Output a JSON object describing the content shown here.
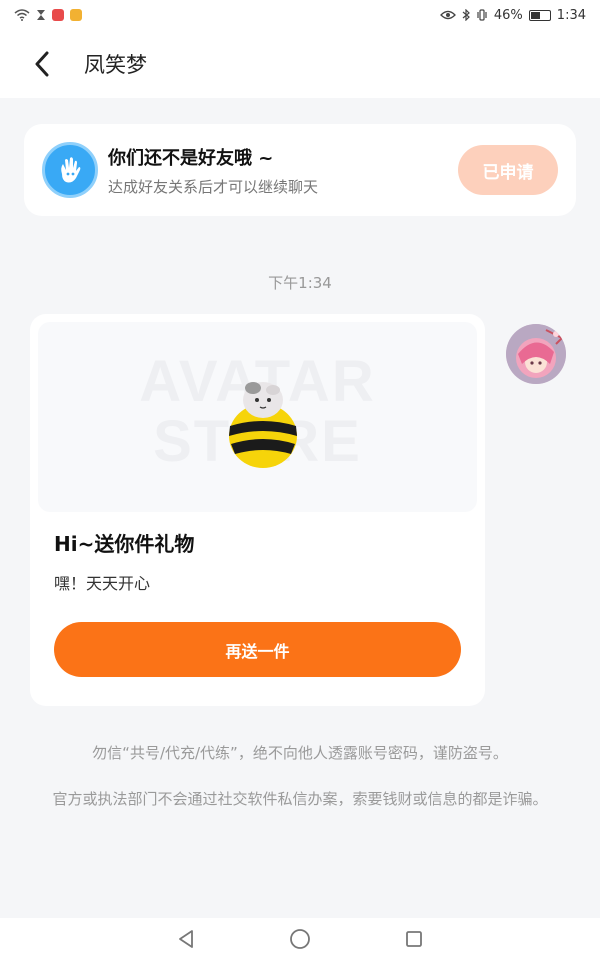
{
  "status_bar": {
    "battery": "46%",
    "time": "1:34",
    "icons": [
      "wifi-icon",
      "hourglass-icon",
      "app-notification-icon",
      "app-notification-icon",
      "eye-icon",
      "bluetooth-icon",
      "vibrate-icon",
      "battery-icon"
    ]
  },
  "header": {
    "title": "凤笑梦",
    "back_icon": "chevron-left-icon"
  },
  "friend_banner": {
    "title": "你们还不是好友哦 ~",
    "subtitle": "达成好友关系后才可以继续聊天",
    "button_label": "已申请",
    "icon": "waving-hand-icon"
  },
  "chat": {
    "timestamp": "下午1:34",
    "gift": {
      "title": "Hi~送你件礼物",
      "message": "嘿！天天开心",
      "button_label": "再送一件",
      "watermark": "AVATAR STORE"
    }
  },
  "warnings": {
    "line1": "勿信“共号/代充/代练”，绝不向他人透露账号密码，谨防盗号。",
    "line2": "官方或执法部门不会通过社交软件私信办案，索要钱财或信息的都是诈骗。"
  },
  "nav_bar": {
    "icons": [
      "back-triangle-icon",
      "home-circle-icon",
      "recents-square-icon"
    ]
  },
  "colors": {
    "accent": "#fb7317",
    "applied_button": "#fdd0bc",
    "wave_icon": "#39a9f5"
  }
}
